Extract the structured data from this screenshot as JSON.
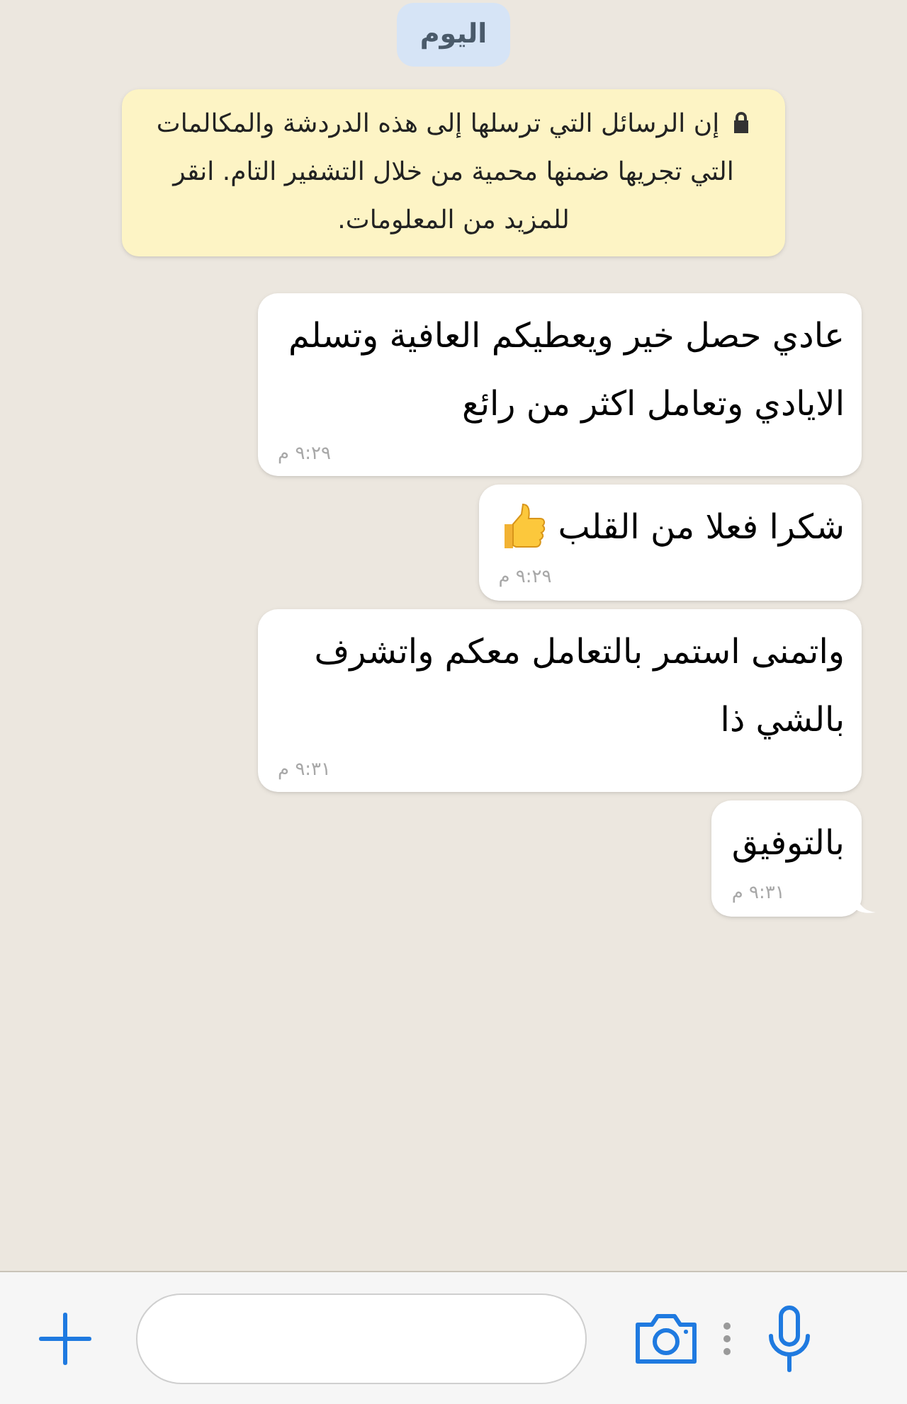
{
  "date_chip": "اليوم",
  "encryption_notice": {
    "text": "إن الرسائل التي ترسلها إلى هذه الدردشة والمكالمات التي تجريها ضمنها محمية من خلال التشفير التام. انقر للمزيد من المعلومات."
  },
  "messages": [
    {
      "text": "عادي حصل خير ويعطيكم العافية وتسلم الايادي وتعامل اكثر من رائع",
      "time": "٩:٢٩ م",
      "thumbs_up": false,
      "tail": false
    },
    {
      "text": "شكرا فعلا من القلب",
      "time": "٩:٢٩ م",
      "thumbs_up": true,
      "tail": false
    },
    {
      "text": "واتمنى استمر بالتعامل معكم واتشرف بالشي ذا",
      "time": "٩:٣١ م",
      "thumbs_up": false,
      "tail": false
    },
    {
      "text": "بالتوفيق",
      "time": "٩:٣١ م",
      "thumbs_up": false,
      "tail": true
    }
  ]
}
